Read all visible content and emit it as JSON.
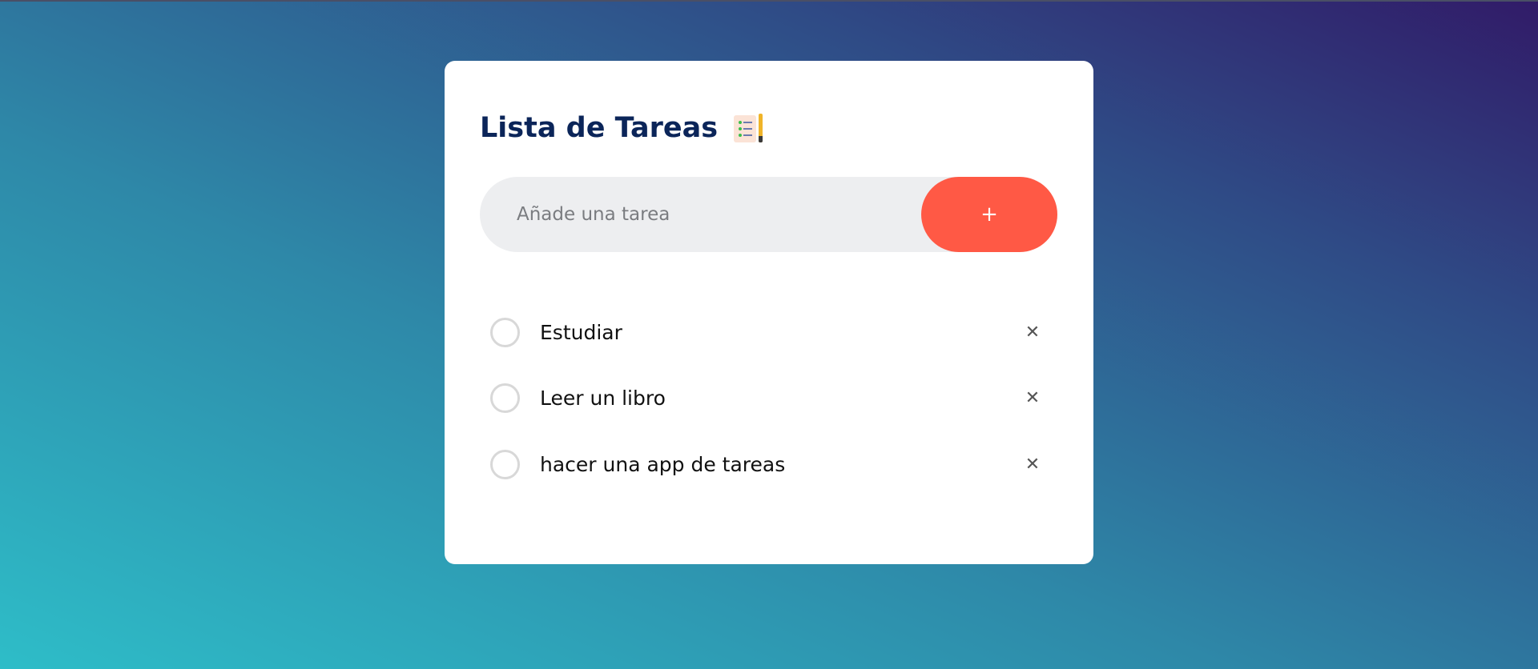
{
  "app": {
    "title": "Lista de Tareas",
    "title_icon": "notepad-pencil-emoji"
  },
  "add_form": {
    "placeholder": "Añade una tarea",
    "value": "",
    "add_label": "+"
  },
  "tasks": [
    {
      "text": "Estudiar",
      "done": false,
      "delete_label": "✕"
    },
    {
      "text": "Leer un libro",
      "done": false,
      "delete_label": "✕"
    },
    {
      "text": "hacer una app de tareas",
      "done": false,
      "delete_label": "✕"
    }
  ],
  "colors": {
    "accent": "#ff5945",
    "title": "#0b2559",
    "input_bg": "#edeef0",
    "gradient_start": "#2ebdc8",
    "gradient_end": "#311b68"
  }
}
